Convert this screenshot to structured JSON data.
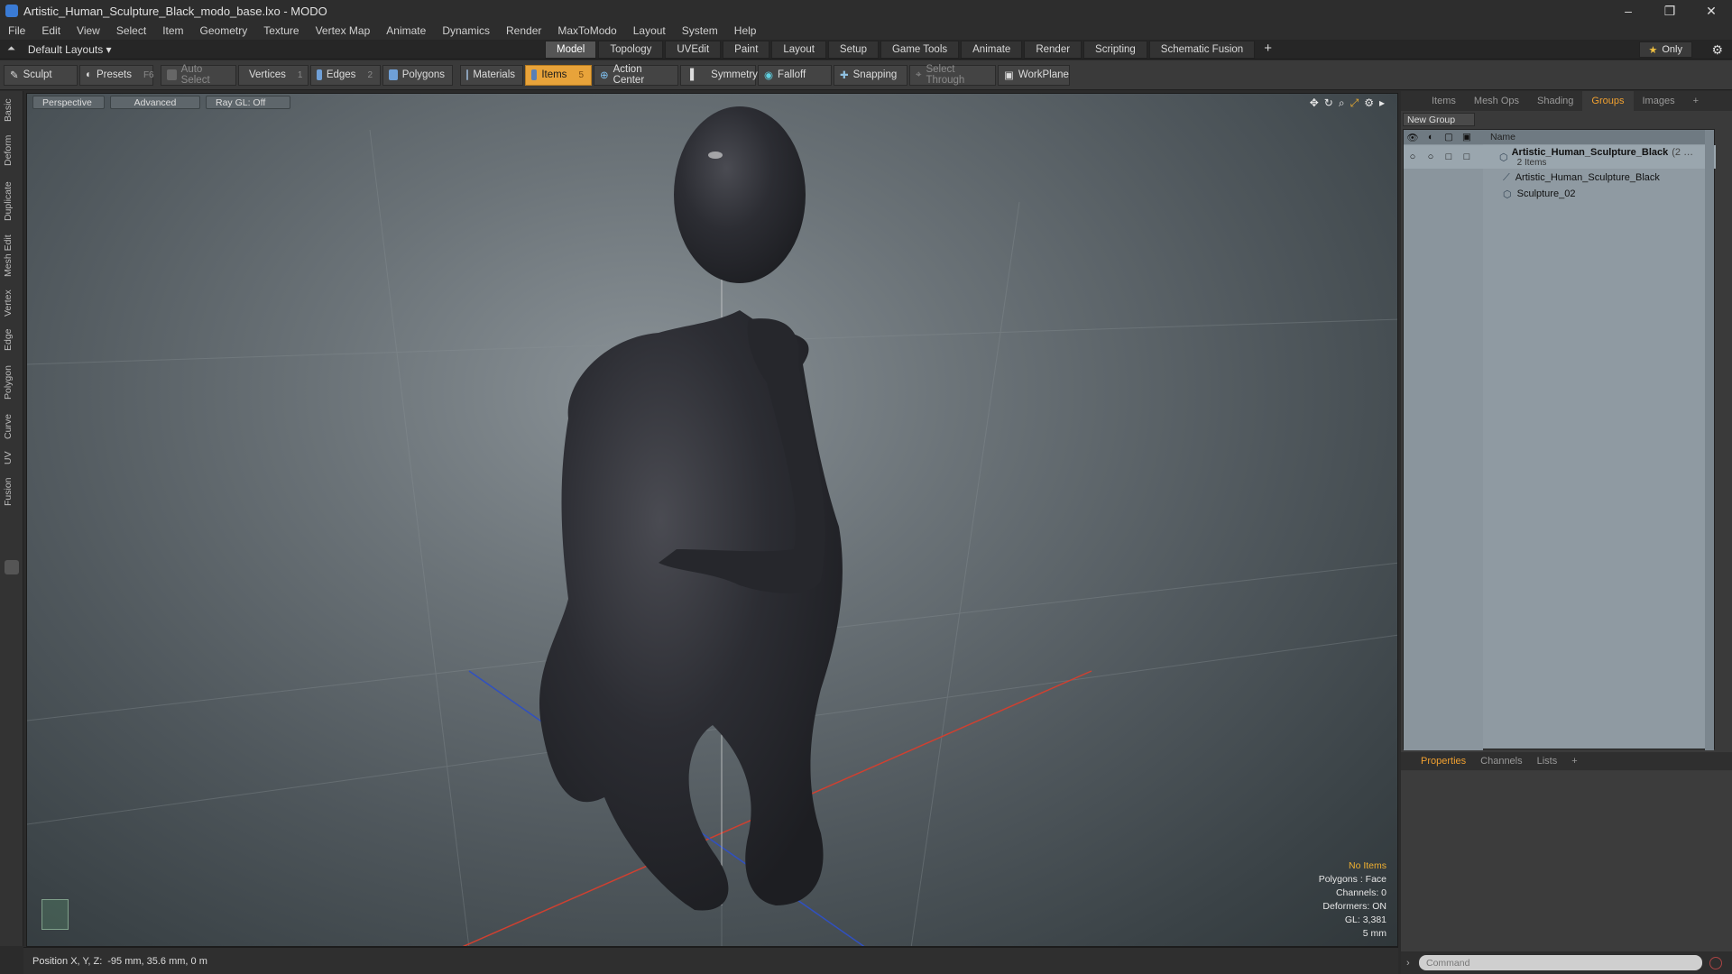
{
  "window": {
    "title": "Artistic_Human_Sculpture_Black_modo_base.lxo - MODO",
    "minimize": "–",
    "maximize": "❐",
    "close": "✕"
  },
  "menu": [
    "File",
    "Edit",
    "View",
    "Select",
    "Item",
    "Geometry",
    "Texture",
    "Vertex Map",
    "Animate",
    "Dynamics",
    "Render",
    "MaxToModo",
    "Layout",
    "System",
    "Help"
  ],
  "layoutbar": {
    "layout_label": "Default Layouts ▾",
    "tabs": [
      "Model",
      "Topology",
      "UVEdit",
      "Paint",
      "Layout",
      "Setup",
      "Game Tools",
      "Animate",
      "Render",
      "Scripting",
      "Schematic Fusion"
    ],
    "active_tab": "Model",
    "plus": "+",
    "only_label": "Only"
  },
  "toolbar": {
    "sculpt": "Sculpt",
    "presets": "Presets",
    "presets_key": "F6",
    "auto_select": "Auto Select",
    "vertices": "Vertices",
    "vertices_key": "1",
    "edges": "Edges",
    "edges_key": "2",
    "polygons": "Polygons",
    "materials": "Materials",
    "items": "Items",
    "items_key": "5",
    "action_center": "Action Center",
    "symmetry": "Symmetry",
    "falloff": "Falloff",
    "snapping": "Snapping",
    "select_through": "Select Through",
    "workplane": "WorkPlane"
  },
  "left_tabs": [
    "Basic",
    "Deform",
    "Duplicate",
    "Mesh Edit",
    "Vertex",
    "Edge",
    "Polygon",
    "Curve",
    "UV",
    "Fusion"
  ],
  "viewport": {
    "view_mode": "Perspective",
    "shading": "Advanced",
    "raygl": "Ray GL: Off",
    "stats": {
      "no_items": "No Items",
      "polygons": "Polygons : Face",
      "channels": "Channels: 0",
      "deformers": "Deformers: ON",
      "gl": "GL: 3,381",
      "scale": "5 mm"
    }
  },
  "right_panel": {
    "tabs": [
      "Items",
      "Mesh Ops",
      "Shading",
      "Groups",
      "Images"
    ],
    "active_tab": "Groups",
    "plus": "+",
    "new_group": "New Group",
    "name_header": "Name",
    "group_name": "Artistic_Human_Sculpture_Black",
    "group_count_suffix": "(2 …",
    "group_items": "2 Items",
    "children": [
      "Artistic_Human_Sculpture_Black",
      "Sculpture_02"
    ],
    "bottom_tabs": [
      "Properties",
      "Channels",
      "Lists"
    ],
    "bottom_active": "Properties",
    "command_placeholder": "Command"
  },
  "statusbar": {
    "position_label": "Position X, Y, Z:",
    "position_value": "-95 mm, 35.6 mm, 0 m"
  },
  "colors": {
    "accent": "#e8a33a",
    "tab_active_text": "#f0a030"
  }
}
